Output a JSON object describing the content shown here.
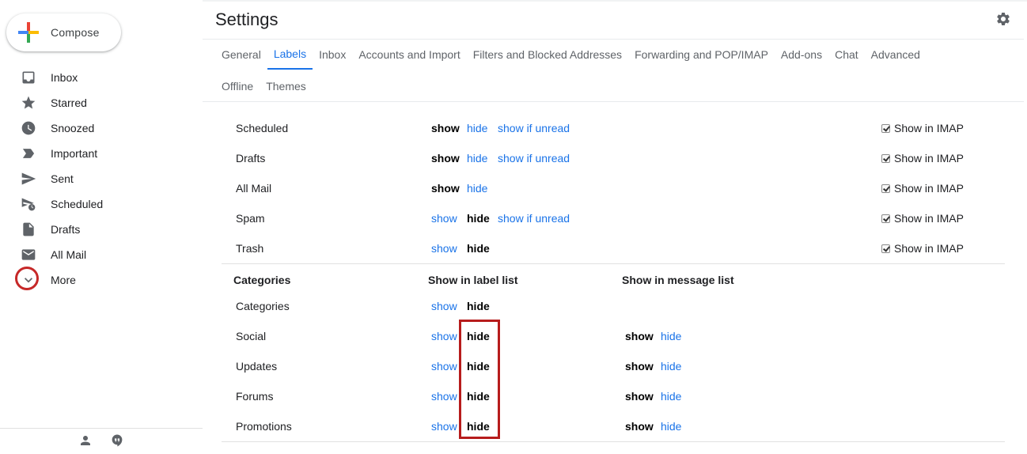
{
  "sidebar": {
    "compose_label": "Compose",
    "items": [
      {
        "label": "Inbox",
        "icon": "inbox-icon"
      },
      {
        "label": "Starred",
        "icon": "star-icon"
      },
      {
        "label": "Snoozed",
        "icon": "clock-icon"
      },
      {
        "label": "Important",
        "icon": "important-icon"
      },
      {
        "label": "Sent",
        "icon": "send-icon"
      },
      {
        "label": "Scheduled",
        "icon": "scheduled-send-icon"
      },
      {
        "label": "Drafts",
        "icon": "draft-icon"
      },
      {
        "label": "All Mail",
        "icon": "mail-icon"
      },
      {
        "label": "More",
        "icon": "chevron-down-icon"
      }
    ],
    "footer_icons": [
      "person-icon",
      "hangouts-icon"
    ]
  },
  "header": {
    "title": "Settings",
    "settings_icon": "gear-icon"
  },
  "tabs": {
    "row1": [
      "General",
      "Labels",
      "Inbox",
      "Accounts and Import",
      "Filters and Blocked Addresses",
      "Forwarding and POP/IMAP",
      "Add-ons",
      "Chat",
      "Advanced"
    ],
    "row2": [
      "Offline",
      "Themes"
    ],
    "active": "Labels"
  },
  "system_labels": [
    {
      "name": "Scheduled",
      "show": "show",
      "hide": "hide",
      "unread": "show if unread",
      "state": "show",
      "imap": "Show in IMAP"
    },
    {
      "name": "Drafts",
      "show": "show",
      "hide": "hide",
      "unread": "show if unread",
      "state": "show",
      "imap": "Show in IMAP"
    },
    {
      "name": "All Mail",
      "show": "show",
      "hide": "hide",
      "state": "show",
      "imap": "Show in IMAP"
    },
    {
      "name": "Spam",
      "show": "show",
      "hide": "hide",
      "unread": "show if unread",
      "state": "hide",
      "imap": "Show in IMAP"
    },
    {
      "name": "Trash",
      "show": "show",
      "hide": "hide",
      "state": "hide",
      "imap": "Show in IMAP"
    }
  ],
  "categories": {
    "header": {
      "col1": "Categories",
      "col2": "Show in label list",
      "col3": "Show in message list"
    },
    "rows": [
      {
        "name": "Categories",
        "show": "show",
        "hide": "hide"
      },
      {
        "name": "Social",
        "show": "show",
        "hide": "hide",
        "msg_show": "show",
        "msg_hide": "hide"
      },
      {
        "name": "Updates",
        "show": "show",
        "hide": "hide",
        "msg_show": "show",
        "msg_hide": "hide"
      },
      {
        "name": "Forums",
        "show": "show",
        "hide": "hide",
        "msg_show": "show",
        "msg_hide": "hide"
      },
      {
        "name": "Promotions",
        "show": "show",
        "hide": "hide",
        "msg_show": "show",
        "msg_hide": "hide"
      }
    ]
  }
}
